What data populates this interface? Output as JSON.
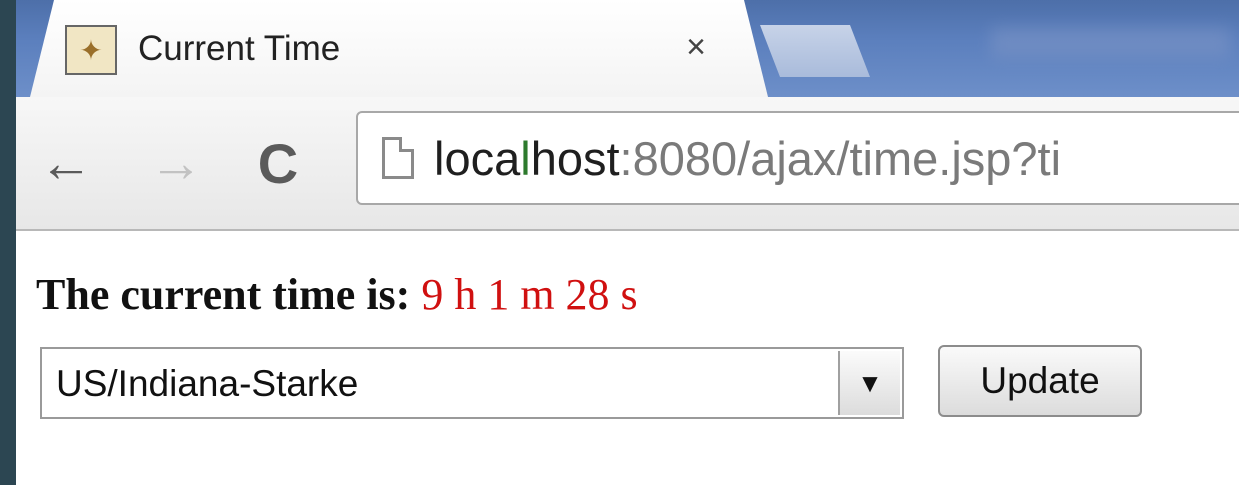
{
  "tab": {
    "title": "Current Time",
    "close_symbol": "×",
    "favicon": "tomcat-favicon"
  },
  "toolbar": {
    "back_symbol": "←",
    "forward_symbol": "→",
    "reload_symbol": "C",
    "url": {
      "host_pre": "loca",
      "host_green": "l",
      "host_post": "host",
      "rest": ":8080/ajax/time.jsp?ti"
    }
  },
  "page": {
    "time_label": "The current time is:",
    "time_value": "9 h 1 m 28 s",
    "timezone_select": {
      "selected": "US/Indiana-Starke",
      "arrow_symbol": "▼"
    },
    "update_label": "Update"
  },
  "colors": {
    "time_value": "#d01010",
    "tabstrip": "#5b7fbd",
    "backdrop": "#2c4652"
  }
}
